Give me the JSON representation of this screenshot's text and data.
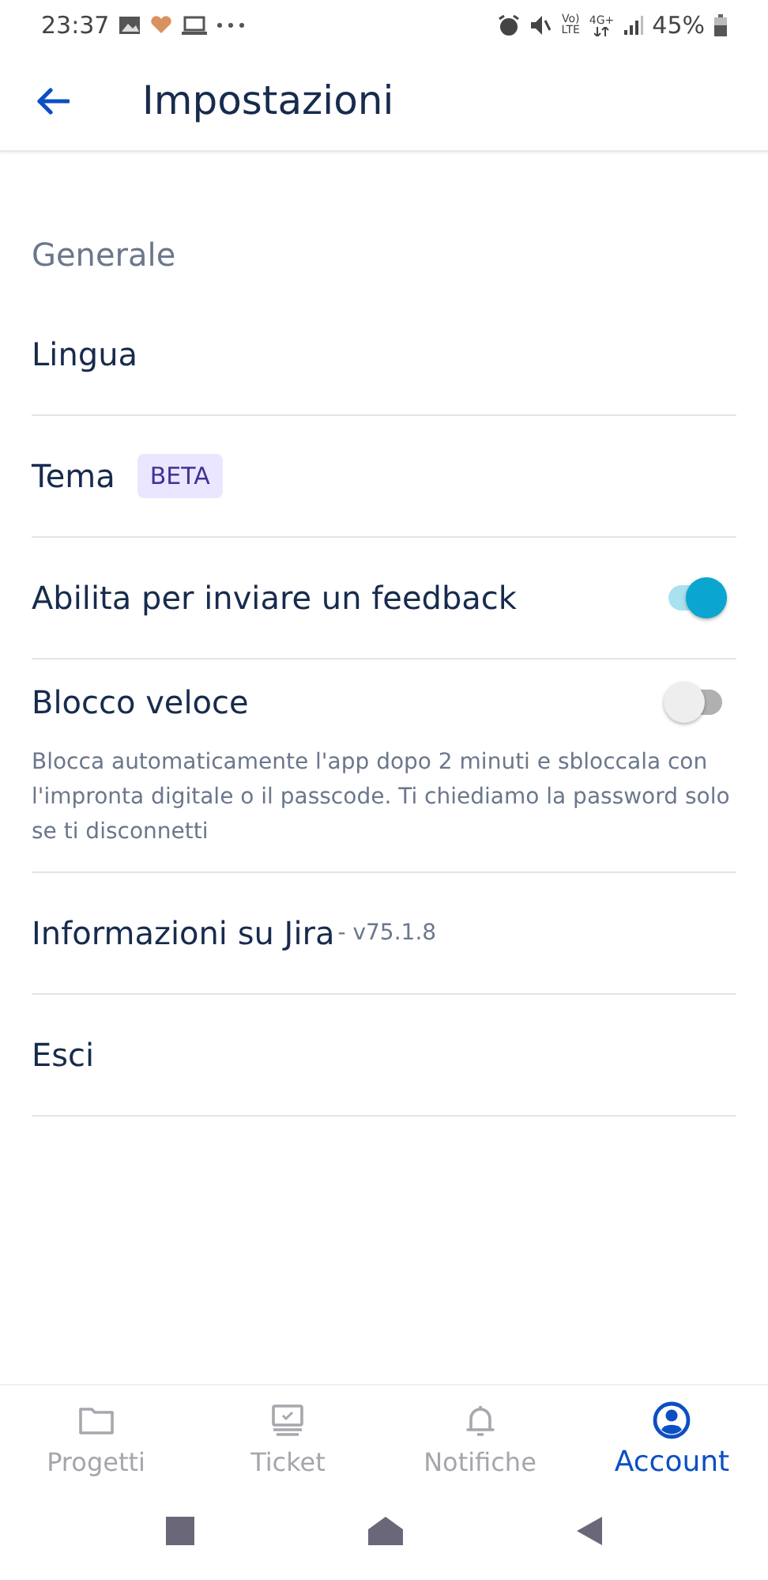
{
  "status_bar": {
    "time": "23:37",
    "volte": "Vo)",
    "lte": "LTE",
    "network": "4G+",
    "battery": "45%"
  },
  "app_bar": {
    "title": "Impostazioni"
  },
  "section": {
    "title": "Generale"
  },
  "items": [
    {
      "kind": "link",
      "label": "Lingua"
    },
    {
      "kind": "tag",
      "label": "Tema",
      "badge": "BETA"
    },
    {
      "kind": "toggle",
      "label": "Abilita per inviare un feedback",
      "on": true
    },
    {
      "kind": "toggle",
      "label": "Blocco veloce",
      "on": false,
      "description": "Blocca automaticamente l'app dopo 2 minuti e sbloccala con l'impronta digitale o il passcode. Ti chiediamo la password solo se ti disconnetti"
    },
    {
      "kind": "version",
      "label": "Informazioni su Jira",
      "version": "- v75.1.8"
    },
    {
      "kind": "link",
      "label": "Esci"
    }
  ],
  "bottom_nav": [
    {
      "label": "Progetti",
      "selected": false
    },
    {
      "label": "Ticket",
      "selected": false
    },
    {
      "label": "Notifiche",
      "selected": false
    },
    {
      "label": "Account",
      "selected": true
    }
  ]
}
